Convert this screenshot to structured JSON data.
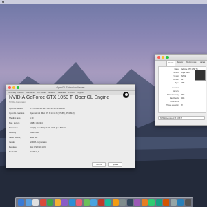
{
  "menubar": {
    "items": [
      "",
      "",
      ""
    ]
  },
  "gl_window": {
    "title": "OpenGL Extension Viewer",
    "tabs": [
      "Summary",
      "OpenGL",
      "Extensions",
      "Test Scene",
      "Renderer",
      "Database",
      "Profiles",
      "Support"
    ],
    "heading": "NVIDIA GeForce GTX 1050 Ti OpenGL Engine",
    "subheading": "NVIDIA Corporation",
    "rows": [
      {
        "label": "OpenGL version",
        "value": "4.1 NVIDIA-10.33.0 387.10.10.10.40.105"
      },
      {
        "label": "OpenGL Features",
        "value": "OpenGL 1.1 (Mac OS X 10.13.6 (17G65), IPKGM-2)"
      },
      {
        "label": "Shading lang.",
        "value": "4.10"
      },
      {
        "label": "Max. texture",
        "value": "16384 × 16384"
      },
      {
        "label": "Processor",
        "value": "Intel(R) Core(TM) i7 CPU  920  @ 2.67GHz"
      },
      {
        "label": "Memory",
        "value": "16384 MB"
      },
      {
        "label": "Video memory",
        "value": "4096 MB"
      },
      {
        "label": "Vendor",
        "value": "NVIDIA Corporation"
      },
      {
        "label": "Renderer",
        "value": "Mac OS X 10.13.6"
      },
      {
        "label": "Model ID",
        "value": "MacPro5,1"
      }
    ],
    "buttons": [
      "Submit",
      "Update"
    ]
  },
  "mac_window": {
    "tabs": [
      "Device",
      "Memory",
      "Performance",
      "Games"
    ],
    "rows": [
      {
        "key": "Name",
        "value": "GeForce GTX 1050 Ti"
      },
      {
        "key": "Platform",
        "value": "Apple Metal"
      },
      {
        "key": "Vendor",
        "value": "NVIDIA"
      },
      {
        "key": "Version",
        "value": "1.2"
      },
      {
        "key": "Type",
        "value": "GPU"
      },
      {
        "key": "Features",
        "value": ""
      },
      {
        "key": "Memory",
        "value": ""
      },
      {
        "key": "Shared memory",
        "value": "4096"
      },
      {
        "key": "Max threads",
        "value": "1024"
      },
      {
        "key": "Dimensions",
        "value": ""
      },
      {
        "key": "Thread execution",
        "value": "32"
      }
    ],
    "popup_value": "NVIDIA GeForce GTX 1050 Ti"
  },
  "dock": {
    "icon_colors": [
      "#3a7bd5",
      "#5aa0e0",
      "#e0e0e0",
      "#d94a3a",
      "#3fa54a",
      "#f2b134",
      "#8a5cc7",
      "#2c8fd6",
      "#e85d75",
      "#6bbf59",
      "#4aa3df",
      "#c0392b",
      "#1abc9c",
      "#f39c12",
      "#7f8c8d",
      "#34495e",
      "#9b59b6",
      "#e67e22",
      "#2ecc71",
      "#16a085",
      "#d35400",
      "#95a5a6",
      "#2980b9",
      "#555555"
    ]
  }
}
